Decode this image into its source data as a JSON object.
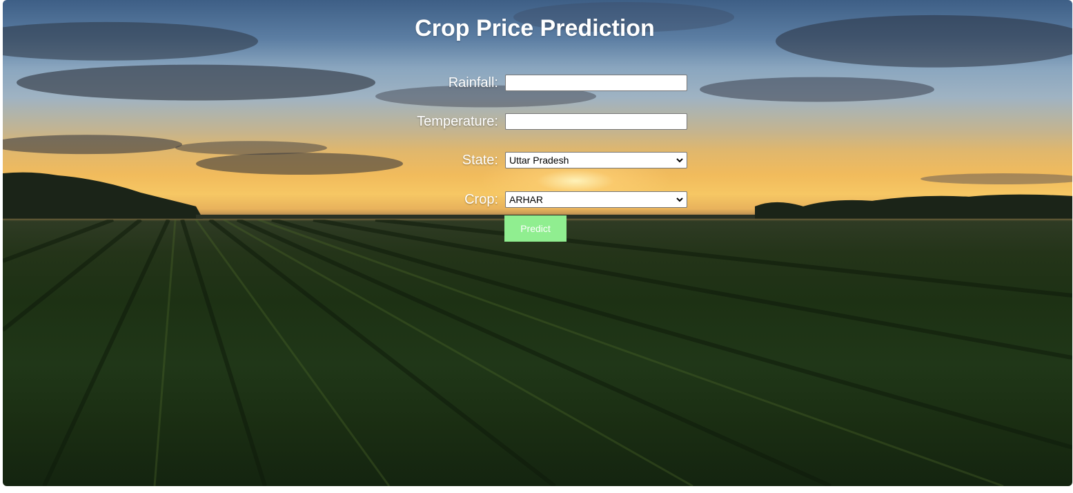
{
  "page": {
    "title": "Crop Price Prediction"
  },
  "form": {
    "rainfall": {
      "label": "Rainfall:",
      "value": "",
      "placeholder": ""
    },
    "temperature": {
      "label": "Temperature:",
      "value": "",
      "placeholder": ""
    },
    "state": {
      "label": "State:",
      "selected": "Uttar Pradesh"
    },
    "crop": {
      "label": "Crop:",
      "selected": "ARHAR"
    },
    "predict_label": "Predict"
  },
  "colors": {
    "button_bg": "#90ee90",
    "text": "#ffffff"
  },
  "icons": {
    "state_dropdown": "chevron-down-icon",
    "crop_dropdown": "chevron-down-icon"
  }
}
